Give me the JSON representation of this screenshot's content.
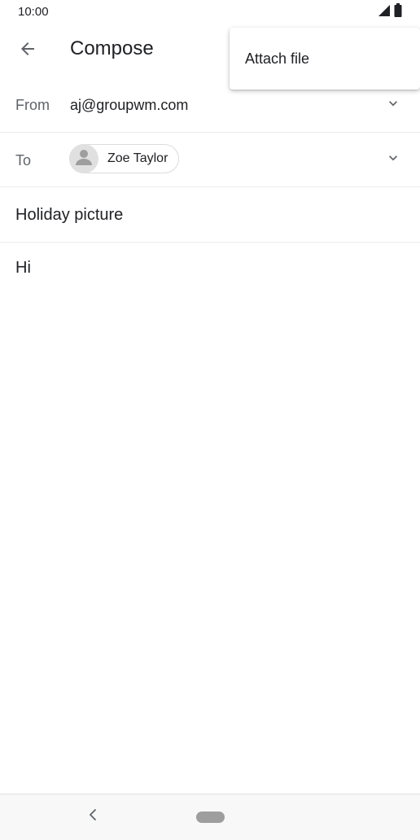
{
  "status_bar": {
    "time": "10:00",
    "icons": [
      "signal-icon",
      "battery-icon"
    ]
  },
  "app_bar": {
    "back_icon": "arrow-back-icon",
    "title": "Compose"
  },
  "compose": {
    "from": {
      "label": "From",
      "value": "aj@groupwm.com",
      "expand_icon": "chevron-down-icon"
    },
    "to": {
      "label": "To",
      "recipients": [
        {
          "name": "Zoe Taylor",
          "avatar_icon": "person-icon"
        }
      ],
      "expand_icon": "chevron-down-icon"
    },
    "subject": "Holiday picture",
    "body": "Hi"
  },
  "overflow_menu": {
    "items": [
      {
        "label": "Attach file"
      }
    ]
  },
  "nav_bar": {
    "back_icon": "nav-back-icon",
    "home_icon": "home-pill-icon"
  },
  "colors": {
    "text_primary": "#202124",
    "text_secondary": "#5f6368",
    "divider": "#ececec",
    "chip_border": "#dadce0",
    "avatar_bg": "#e0e0e0"
  }
}
